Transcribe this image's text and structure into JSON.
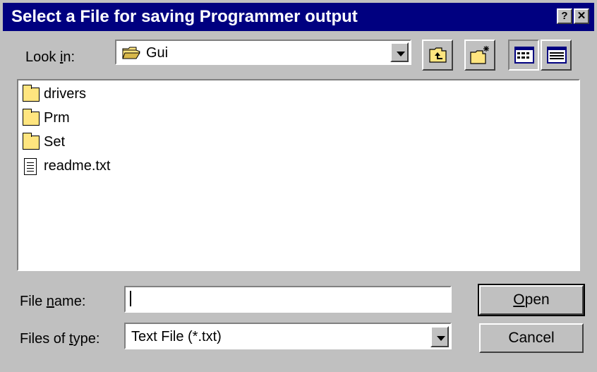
{
  "window": {
    "title": "Select a File for saving Programmer output",
    "help_label": "?",
    "close_label": "✕"
  },
  "look_in": {
    "label_prefix": "Look ",
    "label_accel": "i",
    "label_suffix": "n:",
    "value": "Gui"
  },
  "toolbar": {
    "icons": [
      "up-one-level-icon",
      "create-new-folder-icon",
      "list-view-icon",
      "details-view-icon"
    ]
  },
  "files": [
    {
      "name": "drivers",
      "kind": "folder"
    },
    {
      "name": "Prm",
      "kind": "folder"
    },
    {
      "name": "Set",
      "kind": "folder"
    },
    {
      "name": "readme.txt",
      "kind": "file"
    }
  ],
  "file_name": {
    "label_prefix": "File ",
    "label_accel": "n",
    "label_suffix": "ame:",
    "value": "",
    "placeholder": ""
  },
  "file_type": {
    "label_prefix": "Files of ",
    "label_accel": "t",
    "label_suffix": "ype:",
    "value": "Text File (*.txt)"
  },
  "buttons": {
    "open_accel": "O",
    "open_rest": "pen",
    "cancel_label": "Cancel"
  },
  "colors": {
    "titlebar": "#000080",
    "face": "#c0c0c0",
    "folder": "#ffe57f"
  }
}
